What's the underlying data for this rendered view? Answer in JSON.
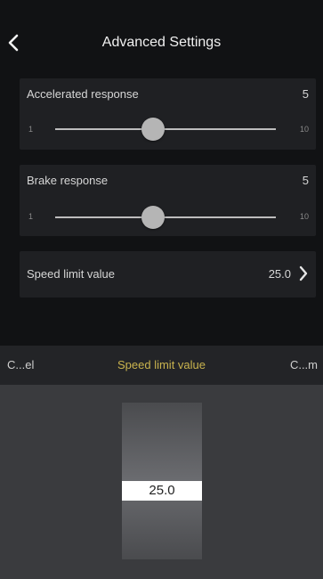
{
  "status_bar": {
    "left": "",
    "center": "",
    "right": ""
  },
  "header": {
    "title": "Advanced Settings"
  },
  "accelerated": {
    "label": "Accelerated response",
    "value": "5",
    "min": "1",
    "max": "10",
    "level": 5
  },
  "brake": {
    "label": "Brake response",
    "value": "5",
    "min": "1",
    "max": "10",
    "level": 5
  },
  "speed_limit": {
    "label": "Speed limit value",
    "value": "25.0"
  },
  "picker": {
    "cancel_label": "C...el",
    "title": "Speed limit value",
    "confirm_label": "C...m",
    "selected": "25.0"
  }
}
